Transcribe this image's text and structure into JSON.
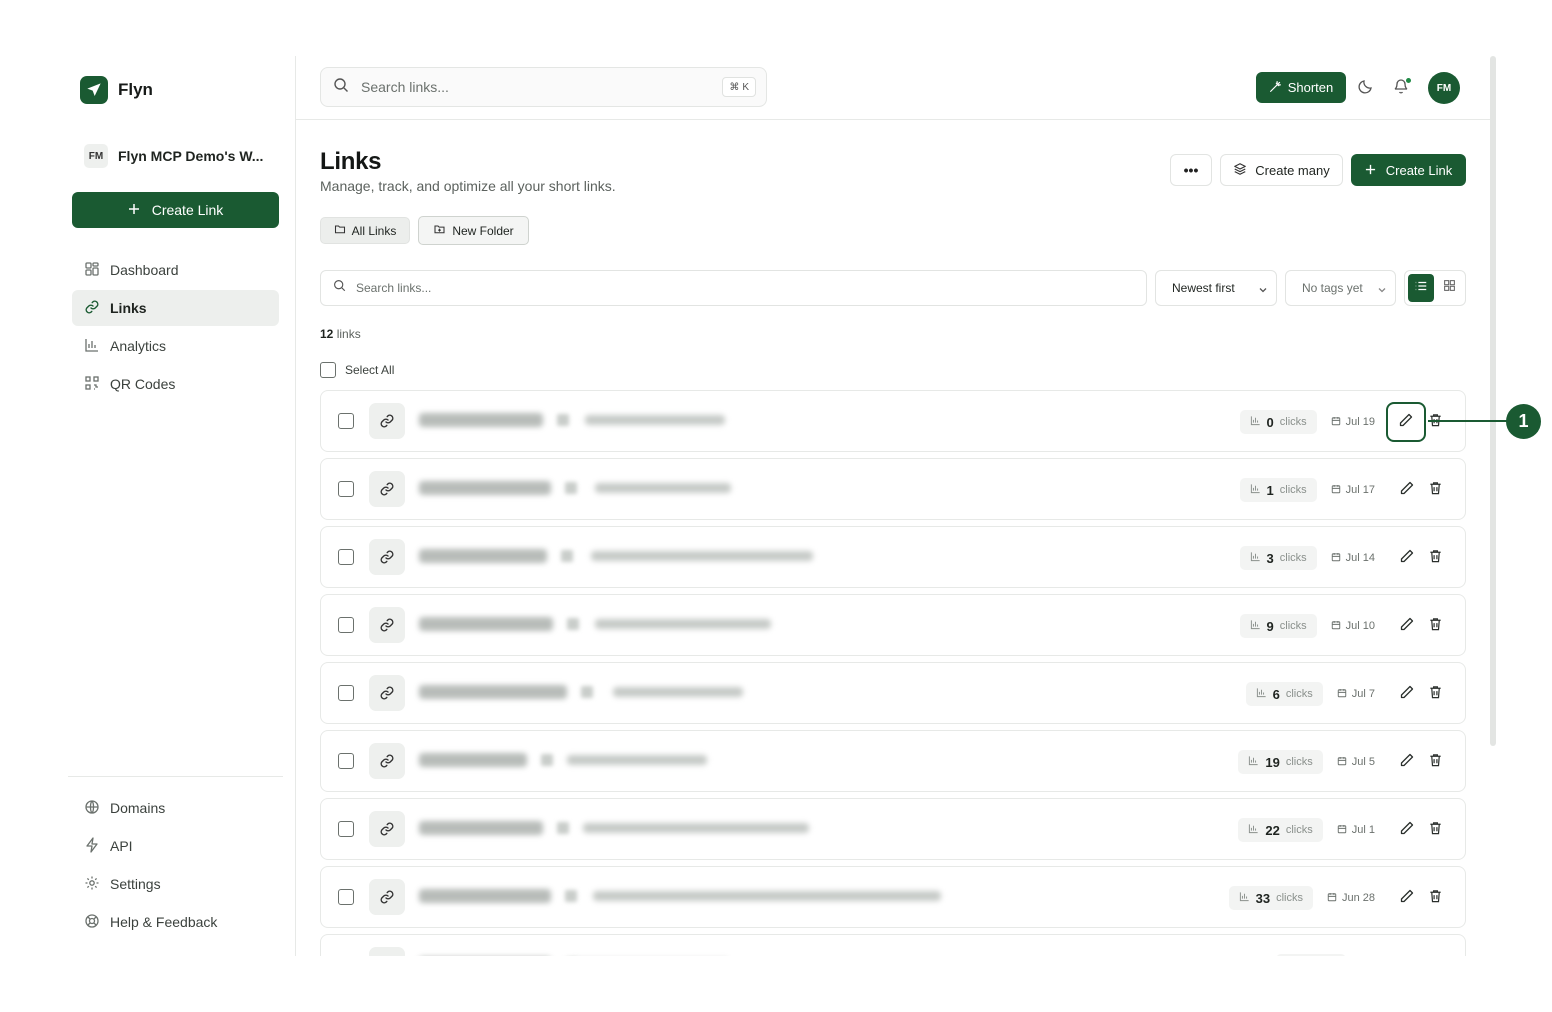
{
  "brand": {
    "name": "Flyn"
  },
  "workspace": {
    "initials": "FM",
    "name": "Flyn MCP Demo's W..."
  },
  "sidebar": {
    "create_label": "Create Link",
    "nav": [
      {
        "label": "Dashboard",
        "icon": "dashboard-icon"
      },
      {
        "label": "Links",
        "icon": "link-icon",
        "active": true
      },
      {
        "label": "Analytics",
        "icon": "analytics-icon"
      },
      {
        "label": "QR Codes",
        "icon": "qr-code-icon"
      }
    ],
    "bottom": [
      {
        "label": "Domains",
        "icon": "globe-icon"
      },
      {
        "label": "API",
        "icon": "bolt-icon"
      },
      {
        "label": "Settings",
        "icon": "gear-icon"
      },
      {
        "label": "Help & Feedback",
        "icon": "help-icon"
      }
    ]
  },
  "topbar": {
    "search_placeholder": "Search links...",
    "shortcut_symbol": "⌘",
    "shortcut_key": "K",
    "shorten_label": "Shorten",
    "avatar_initials": "FM"
  },
  "page": {
    "title": "Links",
    "subtitle": "Manage, track, and optimize all your short links.",
    "more_label": "•••",
    "create_many_label": "Create many",
    "create_link_label": "Create Link"
  },
  "folders": {
    "all_label": "All Links",
    "new_label": "New Folder"
  },
  "filters": {
    "search_placeholder": "Search links...",
    "sort_value": "Newest first",
    "tags_value": "No tags yet"
  },
  "list": {
    "count": "12",
    "count_suffix": "links",
    "select_all_label": "Select All",
    "clicks_unit": "clicks",
    "rows": [
      {
        "clicks": "0",
        "date": "Jul 19"
      },
      {
        "clicks": "1",
        "date": "Jul 17"
      },
      {
        "clicks": "3",
        "date": "Jul 14"
      },
      {
        "clicks": "9",
        "date": "Jul 10"
      },
      {
        "clicks": "6",
        "date": "Jul 7"
      },
      {
        "clicks": "19",
        "date": "Jul 5"
      },
      {
        "clicks": "22",
        "date": "Jul 1"
      },
      {
        "clicks": "33",
        "date": "Jun 28"
      },
      {
        "clicks": "",
        "date": ""
      }
    ]
  },
  "annotation": {
    "label": "1"
  },
  "colors": {
    "accent": "#1a5a32",
    "border": "#e7e9e7",
    "muted": "#6b716d"
  }
}
